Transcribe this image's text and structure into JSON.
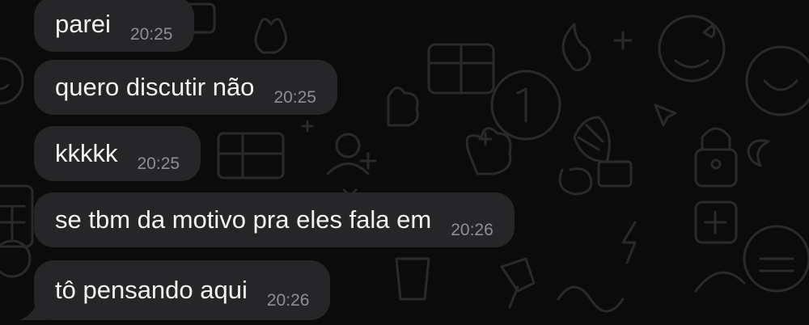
{
  "chat": {
    "messages": [
      {
        "text": "parei",
        "time": "20:25"
      },
      {
        "text": "quero discutir não",
        "time": "20:25"
      },
      {
        "text": "kkkkk",
        "time": "20:25"
      },
      {
        "text": "se tbm da motivo pra eles fala em",
        "time": "20:26"
      },
      {
        "text": "tô pensando aqui",
        "time": "20:26"
      }
    ]
  },
  "wallpaper": {
    "style": "doodle-pattern",
    "color": "#0b0b0b",
    "doodle_color": "#2a2a2a"
  },
  "bubble_color": "#262628"
}
